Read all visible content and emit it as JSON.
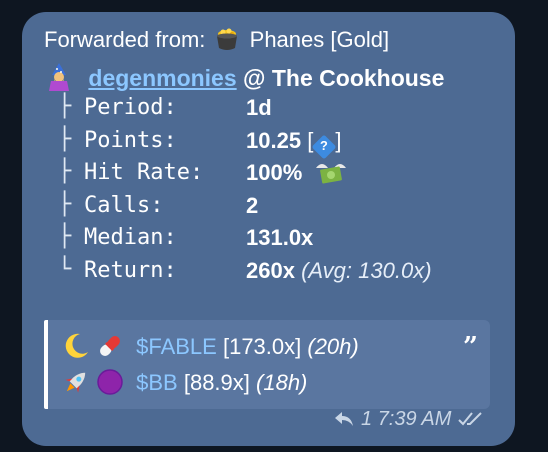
{
  "forward": {
    "prefix": "Forwarded from:",
    "source": "Phanes [Gold]"
  },
  "header": {
    "user": "degenmonies",
    "at": "@",
    "group": "The Cookhouse"
  },
  "stats": [
    {
      "tree": "├",
      "key": "Period:",
      "value": "1d"
    },
    {
      "tree": "├",
      "key": "Points:",
      "value": "10.25"
    },
    {
      "tree": "├",
      "key": "Hit Rate:",
      "value": "100%"
    },
    {
      "tree": "├",
      "key": "Calls:",
      "value": "2"
    },
    {
      "tree": "├",
      "key": "Median:",
      "value": "131.0x"
    },
    {
      "tree": "└",
      "key": "Return:",
      "value": "260x",
      "extra": "(Avg: 130.0x)"
    }
  ],
  "points_help": {
    "open": "[",
    "glyph": "?",
    "close": "]"
  },
  "calls": [
    {
      "ticker": "$FABLE",
      "multiple": "[173.0x]",
      "age": "(20h)",
      "icons": [
        "moon-icon",
        "pill-icon"
      ]
    },
    {
      "ticker": "$BB",
      "multiple": "[88.9x]",
      "age": "(18h)",
      "icons": [
        "rocket-icon",
        "purple-circle-icon"
      ]
    }
  ],
  "quote_mark": "”",
  "footer": {
    "replies": "1",
    "time": "7:39 AM"
  },
  "colors": {
    "bubble": "#4d6a93",
    "link": "#8cc7ff",
    "background": "#0e1621"
  }
}
